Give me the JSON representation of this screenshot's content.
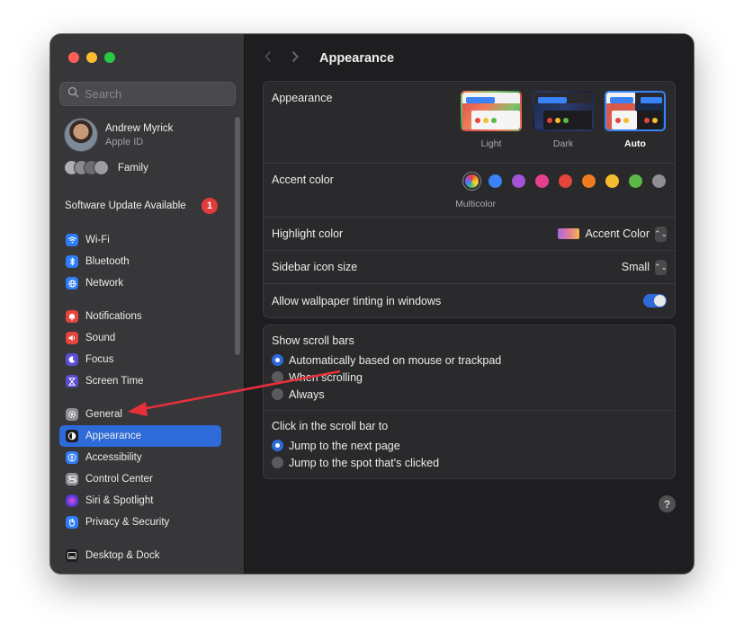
{
  "window": {
    "traffic_colors": [
      "#ff5f57",
      "#febc2e",
      "#28c840"
    ]
  },
  "sidebar": {
    "search_placeholder": "Search",
    "account": {
      "name": "Andrew Myrick",
      "subtitle": "Apple ID"
    },
    "family_label": "Family",
    "update": {
      "label": "Software Update Available",
      "badge": "1"
    },
    "groups": [
      [
        {
          "label": "Wi-Fi",
          "icon": "wifi-icon",
          "color": "#2e7cf6"
        },
        {
          "label": "Bluetooth",
          "icon": "bluetooth-icon",
          "color": "#2e7cf6"
        },
        {
          "label": "Network",
          "icon": "globe-icon",
          "color": "#2e7cf6"
        }
      ],
      [
        {
          "label": "Notifications",
          "icon": "bell-icon",
          "color": "#e5453d"
        },
        {
          "label": "Sound",
          "icon": "speaker-icon",
          "color": "#e5453d"
        },
        {
          "label": "Focus",
          "icon": "moon-icon",
          "color": "#5b4ed3"
        },
        {
          "label": "Screen Time",
          "icon": "hourglass-icon",
          "color": "#5b4ed3"
        }
      ],
      [
        {
          "label": "General",
          "icon": "gear-icon",
          "color": "#8e8e93"
        },
        {
          "label": "Appearance",
          "icon": "appearance-icon",
          "color": "#1c1c1e",
          "active": true
        },
        {
          "label": "Accessibility",
          "icon": "accessibility-icon",
          "color": "#2e7cf6"
        },
        {
          "label": "Control Center",
          "icon": "control-center-icon",
          "color": "#8e8e93"
        },
        {
          "label": "Siri & Spotlight",
          "icon": "siri-icon",
          "color": "#c23fd1"
        },
        {
          "label": "Privacy & Security",
          "icon": "hand-icon",
          "color": "#2e7cf6"
        }
      ],
      [
        {
          "label": "Desktop & Dock",
          "icon": "dock-icon",
          "color": "#1c1c1e"
        }
      ]
    ]
  },
  "main": {
    "title": "Appearance",
    "appearance": {
      "label": "Appearance",
      "options": [
        {
          "label": "Light",
          "selected": false
        },
        {
          "label": "Dark",
          "selected": false
        },
        {
          "label": "Auto",
          "selected": true
        }
      ]
    },
    "accent": {
      "label": "Accent color",
      "selected_label": "Multicolor",
      "colors": [
        "#3a82f7",
        "#a453d9",
        "#e73f8e",
        "#e5453d",
        "#f07b22",
        "#f5bd2d",
        "#5cb947",
        "#8e8e93"
      ]
    },
    "highlight": {
      "label": "Highlight color",
      "value": "Accent Color"
    },
    "icon_size": {
      "label": "Sidebar icon size",
      "value": "Small"
    },
    "tinting": {
      "label": "Allow wallpaper tinting in windows",
      "on": true
    },
    "scroll_bars": {
      "title": "Show scroll bars",
      "options": [
        {
          "label": "Automatically based on mouse or trackpad",
          "selected": true
        },
        {
          "label": "When scrolling",
          "selected": false
        },
        {
          "label": "Always",
          "selected": false
        }
      ]
    },
    "click_scroll": {
      "title": "Click in the scroll bar to",
      "options": [
        {
          "label": "Jump to the next page",
          "selected": true
        },
        {
          "label": "Jump to the spot that's clicked",
          "selected": false
        }
      ]
    },
    "help": "?"
  },
  "annotation": {
    "arrow_color": "#e8303a"
  }
}
